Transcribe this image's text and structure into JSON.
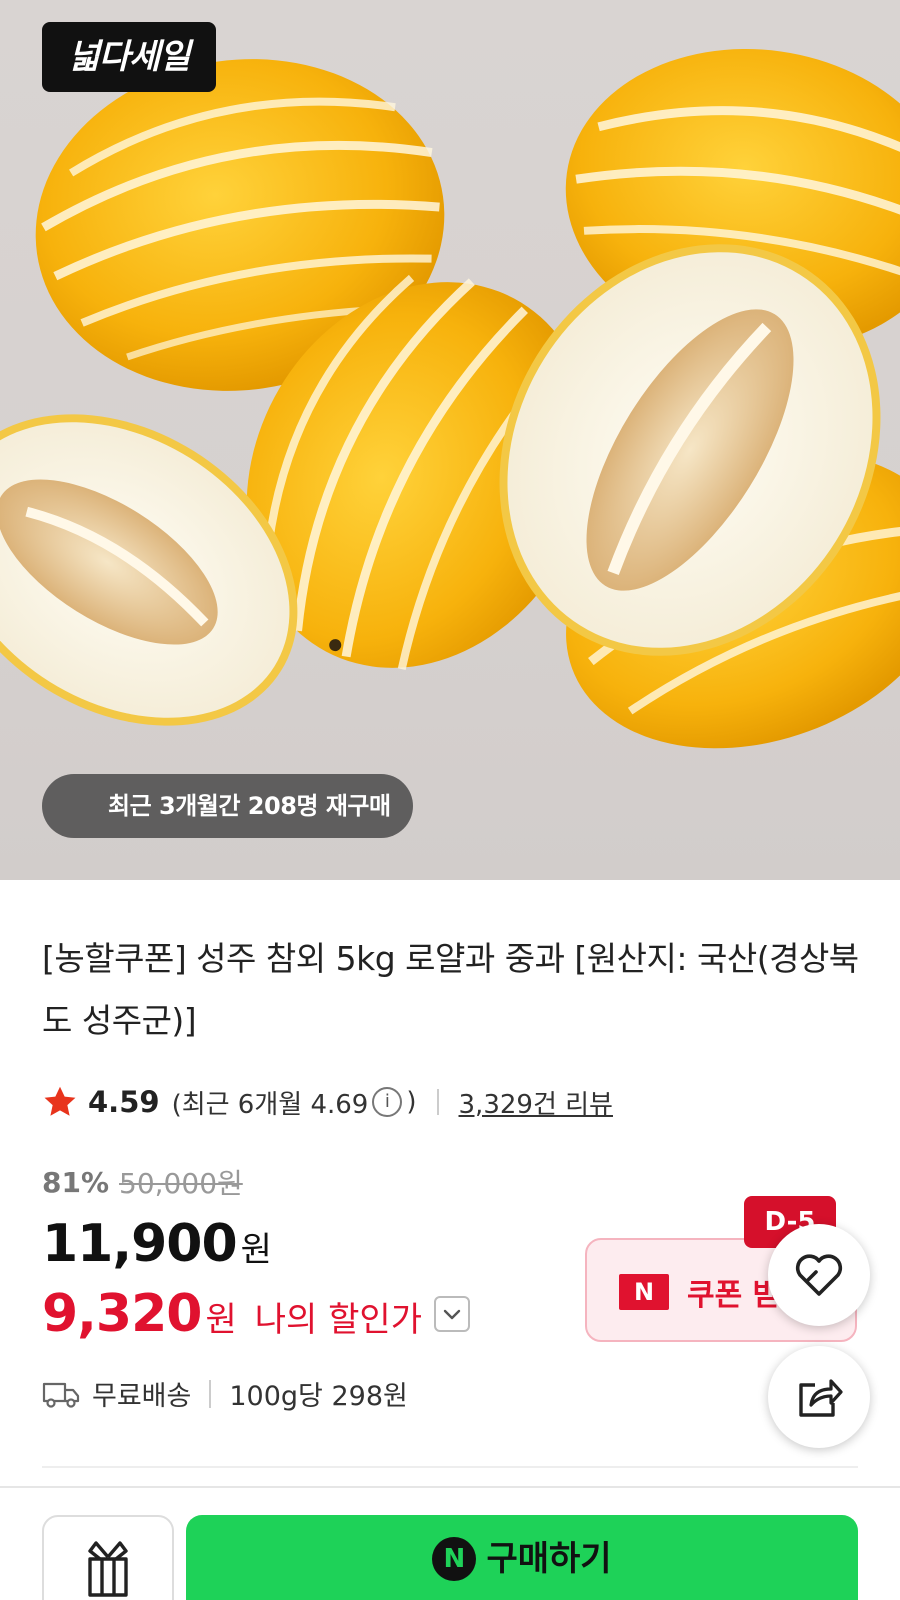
{
  "hero": {
    "sale_logo": "넓다세일",
    "rebuy_text": "최근 3개월간 208명 재구매"
  },
  "product": {
    "title": "[농할쿠폰] 성주 참외 5kg 로얄과 중과 [원산지: 국산(경상북도 성주군)]"
  },
  "rating": {
    "score": "4.59",
    "recent_prefix": "(최근 6개월 4.69",
    "recent_suffix": ")",
    "review_count": "3,329건 리뷰"
  },
  "price": {
    "discount_rate": "81%",
    "original": "50,000원",
    "sale": "11,900",
    "sale_unit": "원",
    "my_price": "9,320",
    "my_price_unit": "원",
    "my_price_label": "나의 할인가"
  },
  "coupon": {
    "badge": "D-5",
    "n_mark": "N",
    "label": "쿠폰 받기"
  },
  "delivery": {
    "shipping": "무료배송",
    "unit_price": "100g당 298원"
  },
  "bottom": {
    "buy_n": "N",
    "buy_label": "구매하기"
  },
  "icons": [
    "star-icon",
    "info-icon",
    "chevron-down-icon",
    "heart-icon",
    "share-icon",
    "truck-icon",
    "gift-icon"
  ],
  "colors": {
    "accent_red": "#e0122f",
    "buy_green": "#1ed258",
    "star": "#e8341c"
  }
}
